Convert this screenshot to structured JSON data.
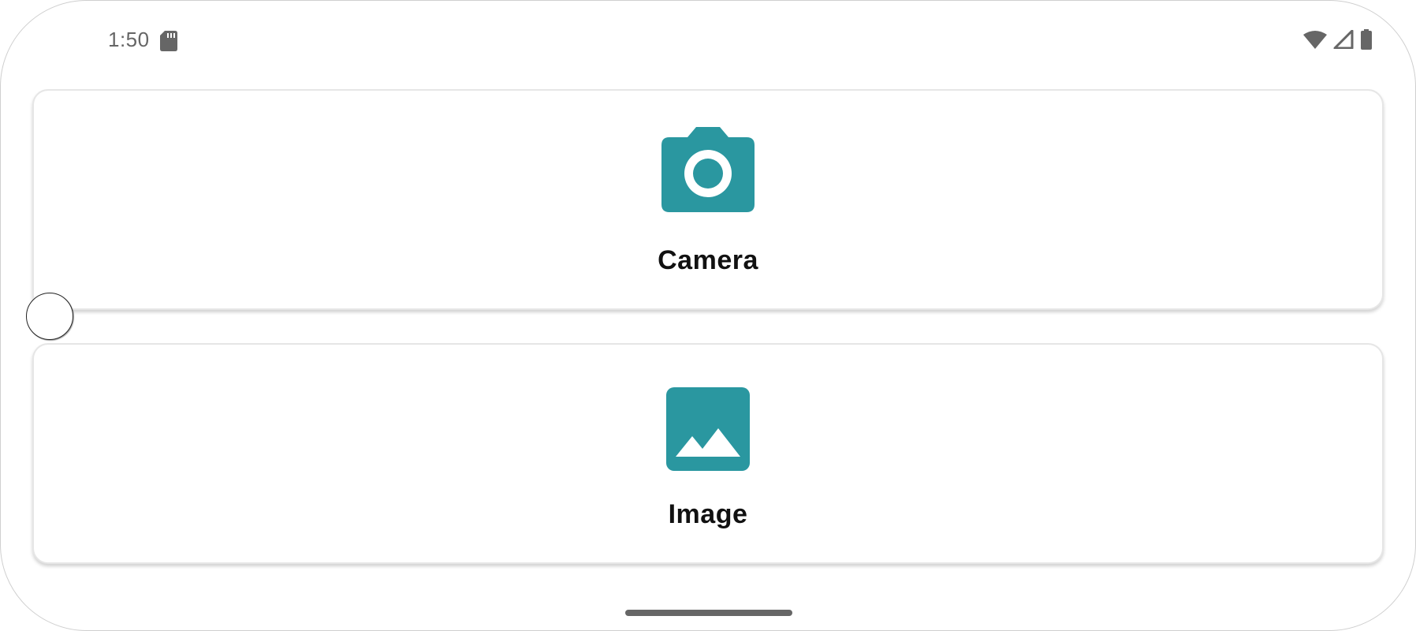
{
  "status_bar": {
    "time": "1:50",
    "left_icons": [
      "sd-card-icon"
    ],
    "right_icons": [
      "wifi-icon",
      "cell-signal-icon",
      "battery-icon"
    ]
  },
  "options": [
    {
      "label": "Camera",
      "icon": "camera-icon"
    },
    {
      "label": "Image",
      "icon": "image-icon"
    }
  ],
  "colors": {
    "accent": "#2A97A0",
    "status_icons": "#666666",
    "label_text": "#111111"
  }
}
